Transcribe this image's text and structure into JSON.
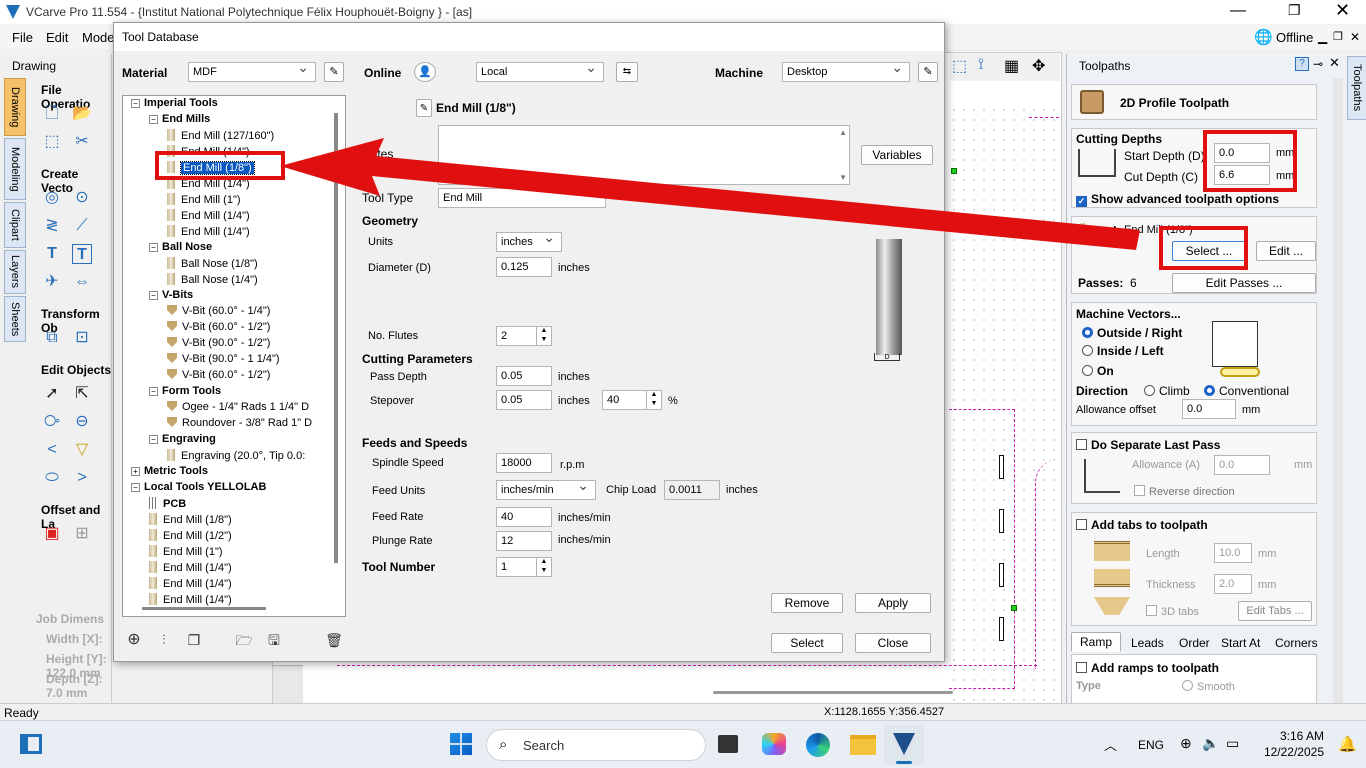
{
  "app": {
    "title": "VCarve Pro 11.554 - {Institut National Polytechnique Félix Houphouët-Boigny } - [as]",
    "offline": "Offline"
  },
  "menu": [
    "File",
    "Edit",
    "Mode"
  ],
  "left": {
    "drawing_tab": "Drawing",
    "side_tabs": [
      "Drawing",
      "Modeling",
      "Clipart",
      "Layers",
      "Sheets"
    ],
    "sections": [
      "File Operatio",
      "Create Vecto",
      "Transform Ob",
      "Edit Objects",
      "Offset and La"
    ],
    "job": {
      "title": "Job Dimens",
      "width": "Width  [X]:",
      "height": "Height [Y]: 122.0 mm",
      "depth": "Depth  [Z]: 7.0 mm"
    }
  },
  "dialog": {
    "title": "Tool Database",
    "material_label": "Material",
    "material": "MDF",
    "online_label": "Online",
    "online": "Local",
    "machine_label": "Machine",
    "machine": "Desktop",
    "tree": [
      {
        "t": "Imperial Tools",
        "lvl": 0,
        "bold": true,
        "fold": "−"
      },
      {
        "t": "End Mills",
        "lvl": 1,
        "bold": true,
        "fold": "−"
      },
      {
        "t": "End Mill (127/160\")",
        "lvl": 2
      },
      {
        "t": "End Mill (1/4\")",
        "lvl": 2
      },
      {
        "t": "End Mill (1/8\")",
        "lvl": 2,
        "sel": true
      },
      {
        "t": "End Mill (1/4\")",
        "lvl": 2
      },
      {
        "t": "End Mill (1\")",
        "lvl": 2
      },
      {
        "t": "End Mill (1/4\")",
        "lvl": 2
      },
      {
        "t": "End Mill (1/4\")",
        "lvl": 2
      },
      {
        "t": "Ball Nose",
        "lvl": 1,
        "bold": true,
        "fold": "−"
      },
      {
        "t": "Ball Nose (1/8\")",
        "lvl": 2
      },
      {
        "t": "Ball Nose (1/4\")",
        "lvl": 2
      },
      {
        "t": "V-Bits",
        "lvl": 1,
        "bold": true,
        "fold": "−"
      },
      {
        "t": "V-Bit (60.0° - 1/4\")",
        "lvl": 2,
        "v": true
      },
      {
        "t": "V-Bit (60.0° - 1/2\")",
        "lvl": 2,
        "v": true
      },
      {
        "t": "V-Bit (90.0° - 1/2\")",
        "lvl": 2,
        "v": true
      },
      {
        "t": "V-Bit (90.0° - 1 1/4\")",
        "lvl": 2,
        "v": true
      },
      {
        "t": "V-Bit (60.0° - 1/2\")",
        "lvl": 2,
        "v": true
      },
      {
        "t": "Form Tools",
        "lvl": 1,
        "bold": true,
        "fold": "−"
      },
      {
        "t": "Ogee - 1/4\" Rads 1 1/4\" D",
        "lvl": 2,
        "v": true
      },
      {
        "t": "Roundover - 3/8\" Rad 1\" D",
        "lvl": 2,
        "v": true
      },
      {
        "t": "Engraving",
        "lvl": 1,
        "bold": true,
        "fold": "−"
      },
      {
        "t": "Engraving (20.0°, Tip 0.0:",
        "lvl": 2
      },
      {
        "t": "Metric Tools",
        "lvl": 0,
        "bold": true,
        "fold": "+"
      },
      {
        "t": "Local Tools YELLOLAB",
        "lvl": 0,
        "bold": true,
        "fold": "−"
      },
      {
        "t": "PCB",
        "lvl": 1,
        "bold": true
      },
      {
        "t": "End Mill (1/8\")",
        "lvl": 1
      },
      {
        "t": "End Mill (1/2\")",
        "lvl": 1
      },
      {
        "t": "End Mill (1\")",
        "lvl": 1
      },
      {
        "t": "End Mill (1/4\")",
        "lvl": 1
      },
      {
        "t": "End Mill (1/4\")",
        "lvl": 1
      },
      {
        "t": "End Mill (1/4\")",
        "lvl": 1
      }
    ],
    "tool_name": "End Mill (1/8\")",
    "notes_label": "Notes",
    "variables": "Variables",
    "tool_type_label": "Tool Type",
    "tool_type": "End Mill",
    "geometry": "Geometry",
    "units_label": "Units",
    "units": "inches",
    "diameter_label": "Diameter (D)",
    "diameter": "0.125",
    "diameter_unit": "inches",
    "flutes_label": "No. Flutes",
    "flutes": "2",
    "cutting": "Cutting Parameters",
    "pass_depth_label": "Pass Depth",
    "pass_depth": "0.05",
    "pass_depth_unit": "inches",
    "stepover_label": "Stepover",
    "stepover": "0.05",
    "stepover_unit": "inches",
    "stepover_pct": "40",
    "pct": "%",
    "feeds": "Feeds and Speeds",
    "spindle_label": "Spindle Speed",
    "spindle": "18000",
    "rpm": "r.p.m",
    "feed_units_label": "Feed Units",
    "feed_units": "inches/min",
    "chip_label": "Chip Load",
    "chip": "0.0011",
    "chip_unit": "inches",
    "feed_rate_label": "Feed Rate",
    "feed_rate": "40",
    "feed_rate_unit": "inches/min",
    "plunge_label": "Plunge Rate",
    "plunge": "12",
    "plunge_unit": "inches/min",
    "tool_number_label": "Tool Number",
    "tool_number": "1",
    "remove": "Remove",
    "apply": "Apply",
    "select": "Select",
    "close": "Close"
  },
  "toolpaths": {
    "header": "Toolpaths",
    "side_tab": "Toolpaths",
    "title": "2D Profile Toolpath",
    "cutting_depths": "Cutting Depths",
    "start_label": "Start Depth (D)",
    "start": "0.0",
    "cut_label": "Cut Depth (C)",
    "cut": "6.6",
    "mm": "mm",
    "advanced": "Show advanced toolpath options",
    "tool_label": "Tool:",
    "tool": "End Mill (1/8\")",
    "select": "Select ...",
    "edit": "Edit ...",
    "passes_label": "Passes:",
    "passes": "6",
    "edit_passes": "Edit Passes ...",
    "machine_vectors": "Machine Vectors...",
    "outside": "Outside / Right",
    "inside": "Inside / Left",
    "on": "On",
    "direction": "Direction",
    "climb": "Climb",
    "conventional": "Conventional",
    "allowance_label": "Allowance offset",
    "allowance": "0.0",
    "separate": "Do Separate Last Pass",
    "allowance_a": "Allowance (A)",
    "allowance_a_val": "0.0",
    "reverse": "Reverse direction",
    "tabs": "Add tabs to toolpath",
    "length": "Length",
    "length_val": "10.0",
    "thickness": "Thickness",
    "thickness_val": "2.0",
    "tabs3d": "3D tabs",
    "edit_tabs": "Edit Tabs ...",
    "bottom_tabs": [
      "Ramp",
      "Leads",
      "Order",
      "Start At",
      "Corners"
    ],
    "ramps": "Add ramps to toolpath",
    "type": "Type",
    "smooth": "Smooth"
  },
  "status": {
    "left": "Ready",
    "coords": "X:1128.1655 Y:356.4527"
  },
  "taskbar": {
    "search": "Search",
    "lang": "ENG",
    "time": "3:16 AM",
    "date": "12/22/2025"
  }
}
